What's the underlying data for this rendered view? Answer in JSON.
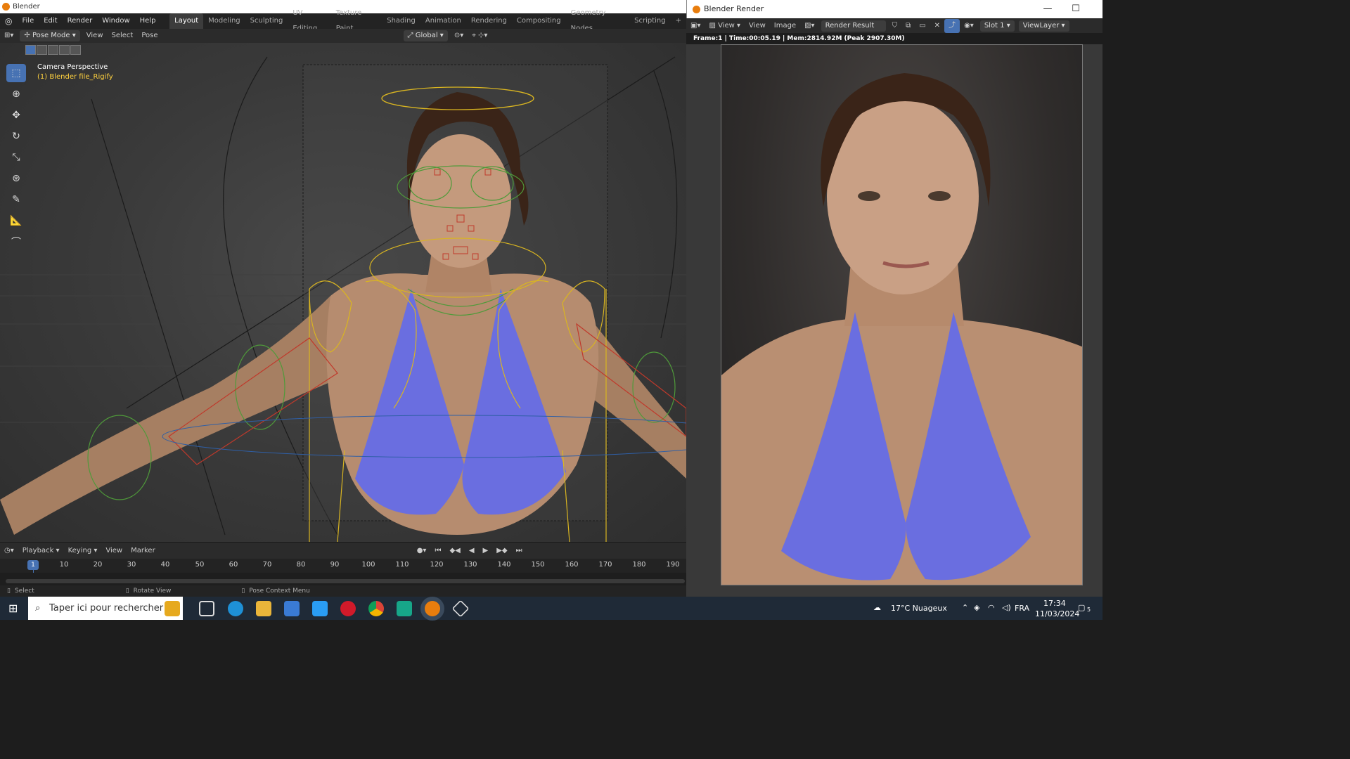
{
  "main_window": {
    "title": "Blender",
    "menus": [
      "File",
      "Edit",
      "Render",
      "Window",
      "Help"
    ],
    "workspaces": [
      "Layout",
      "Modeling",
      "Sculpting",
      "UV Editing",
      "Texture Paint",
      "Shading",
      "Animation",
      "Rendering",
      "Compositing",
      "Geometry Nodes",
      "Scripting"
    ],
    "active_workspace": "Layout",
    "add_workspace": "+"
  },
  "viewport_header": {
    "mode": "Pose Mode",
    "menus": [
      "View",
      "Select",
      "Pose"
    ],
    "transform_orientation": "Global"
  },
  "viewport": {
    "camera_label": "Camera Perspective",
    "object_label": "(1) Blender file_Rigify",
    "tools": [
      "select-box-icon",
      "cursor-icon",
      "move-icon",
      "rotate-icon",
      "scale-icon",
      "transform-icon",
      "annotate-icon",
      "measure-icon",
      "relax-icon"
    ]
  },
  "timeline": {
    "menus": [
      "Playback",
      "Keying",
      "View",
      "Marker"
    ],
    "current_frame": "1",
    "ticks": [
      "10",
      "20",
      "30",
      "40",
      "50",
      "60",
      "70",
      "80",
      "90",
      "100",
      "110",
      "120",
      "130",
      "140",
      "150",
      "160",
      "170",
      "180",
      "190"
    ]
  },
  "statusbar": {
    "select": "Select",
    "rotate": "Rotate View",
    "context": "Pose Context Menu"
  },
  "render_window": {
    "title": "Blender Render",
    "menus": [
      "View",
      "View",
      "Image"
    ],
    "image_name": "Render Result",
    "slot": "Slot 1",
    "view_layer": "ViewLayer",
    "info": "Frame:1 | Time:00:05.19 | Mem:2814.92M (Peak 2907.30M)"
  },
  "taskbar": {
    "search_placeholder": "Taper ici pour rechercher",
    "weather": "17°C  Nuageux",
    "language": "FRA",
    "time": "17:34",
    "date": "11/03/2024",
    "notifications": "5"
  },
  "colors": {
    "accent": "#4772b3",
    "rig_yellow": "#d9b521",
    "rig_green": "#4f9a3a",
    "rig_red": "#c0392b",
    "bikini": "#6a6ee0"
  }
}
